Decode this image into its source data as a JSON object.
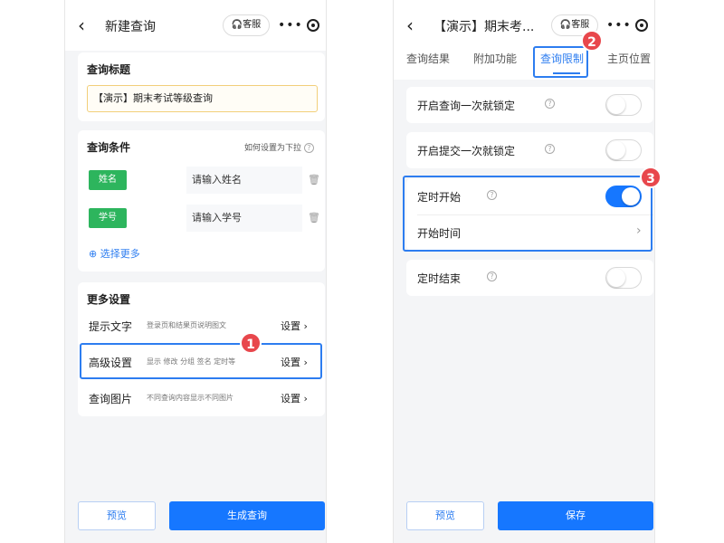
{
  "left_screen": {
    "title": "新建查询",
    "back_icon": "chevron-left-icon",
    "service_label": "客服",
    "query_title_section": {
      "heading": "查询标题",
      "value": "【演示】期末考试等级查询"
    },
    "conditions_section": {
      "heading": "查询条件",
      "hint": "如何设置为下拉",
      "fields": [
        {
          "tag": "姓名",
          "placeholder": "请输入姓名"
        },
        {
          "tag": "学号",
          "placeholder": "请输入学号"
        }
      ],
      "more_label": "选择更多"
    },
    "more_settings": {
      "heading": "更多设置",
      "rows": [
        {
          "label": "提示文字",
          "desc": "登录页和结果页说明图文",
          "action": "设置"
        },
        {
          "label": "高级设置",
          "desc": "显示 修改 分组 签名 定时等",
          "action": "设置"
        },
        {
          "label": "查询图片",
          "desc": "不同查询内容显示不同图片",
          "action": "设置"
        }
      ]
    },
    "buttons": {
      "preview": "预览",
      "generate": "生成查询"
    },
    "badge": "1"
  },
  "right_screen": {
    "title": "【演示】期末考...",
    "back_icon": "chevron-left-icon",
    "service_label": "客服",
    "tabs": [
      "查询结果",
      "附加功能",
      "查询限制",
      "主页位置"
    ],
    "active_tab_index": 2,
    "options": [
      {
        "label": "开启查询一次就锁定",
        "on": false
      },
      {
        "label": "开启提交一次就锁定",
        "on": false
      }
    ],
    "timer_group": {
      "start_label": "定时开始",
      "start_on": true,
      "time_label": "开始时间"
    },
    "timer_end": {
      "label": "定时结束",
      "on": false
    },
    "buttons": {
      "preview": "预览",
      "save": "保存"
    },
    "badges": [
      "2",
      "3"
    ]
  },
  "colors": {
    "accent": "#1677ff",
    "highlight_border": "#2d7df0",
    "tag_green": "#2db55d",
    "badge_red": "#e8474c"
  }
}
